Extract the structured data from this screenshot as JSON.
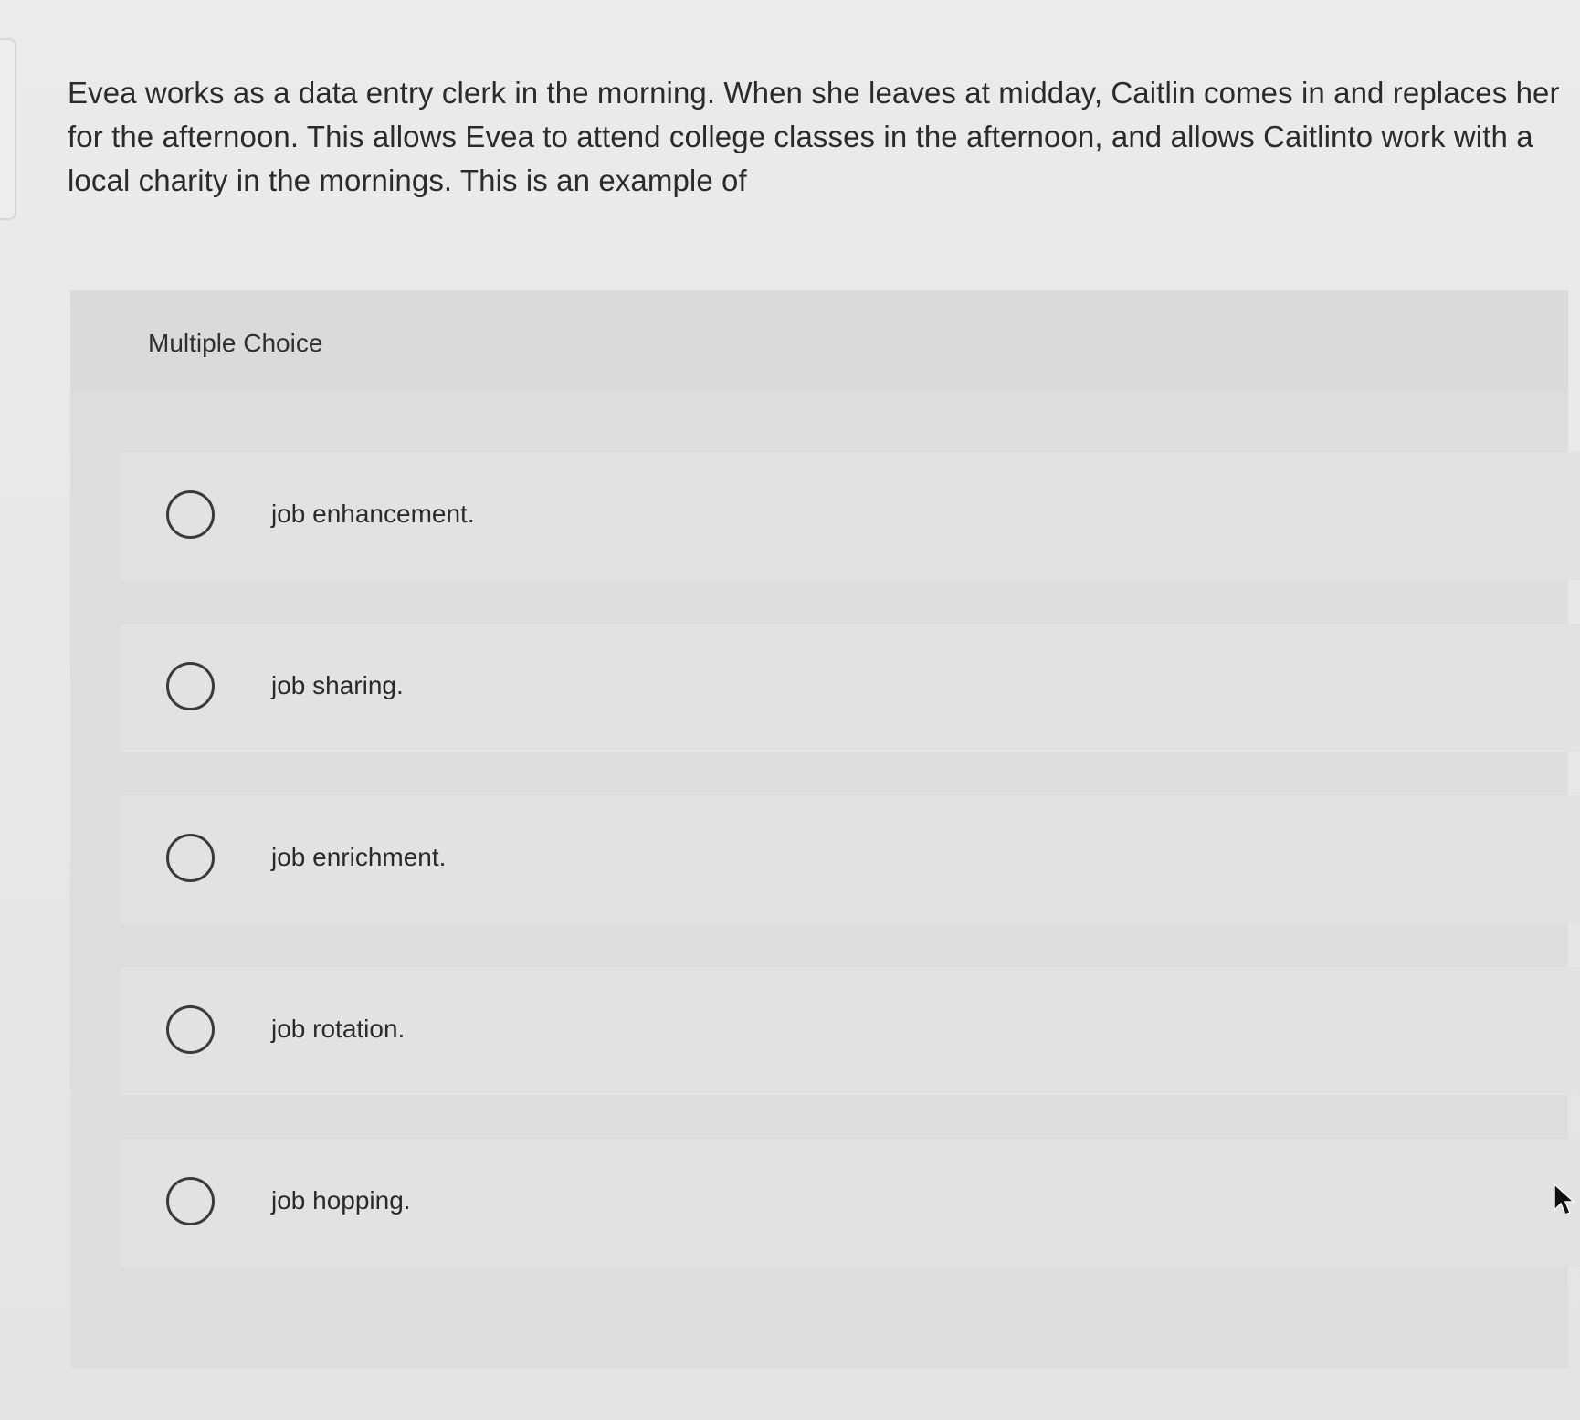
{
  "question": {
    "text": "Evea works as a data entry clerk in the morning. When she leaves at midday, Caitlin comes in and replaces her for the afternoon. This allows Evea to attend college classes in the afternoon, and allows Caitlinto work with a local charity in the mornings. This is an example of"
  },
  "choice_block": {
    "label": "Multiple Choice",
    "options": [
      {
        "label": "job enhancement.",
        "selected": false
      },
      {
        "label": "job sharing.",
        "selected": false
      },
      {
        "label": "job enrichment.",
        "selected": false
      },
      {
        "label": "job rotation.",
        "selected": false
      },
      {
        "label": "job hopping.",
        "selected": false
      }
    ]
  },
  "icons": {
    "radio": "radio-empty-icon",
    "cursor": "mouse-pointer-icon"
  },
  "colors": {
    "background": "#e6e7e6",
    "panel": "#dcdddc",
    "text": "#2b2b2b"
  }
}
